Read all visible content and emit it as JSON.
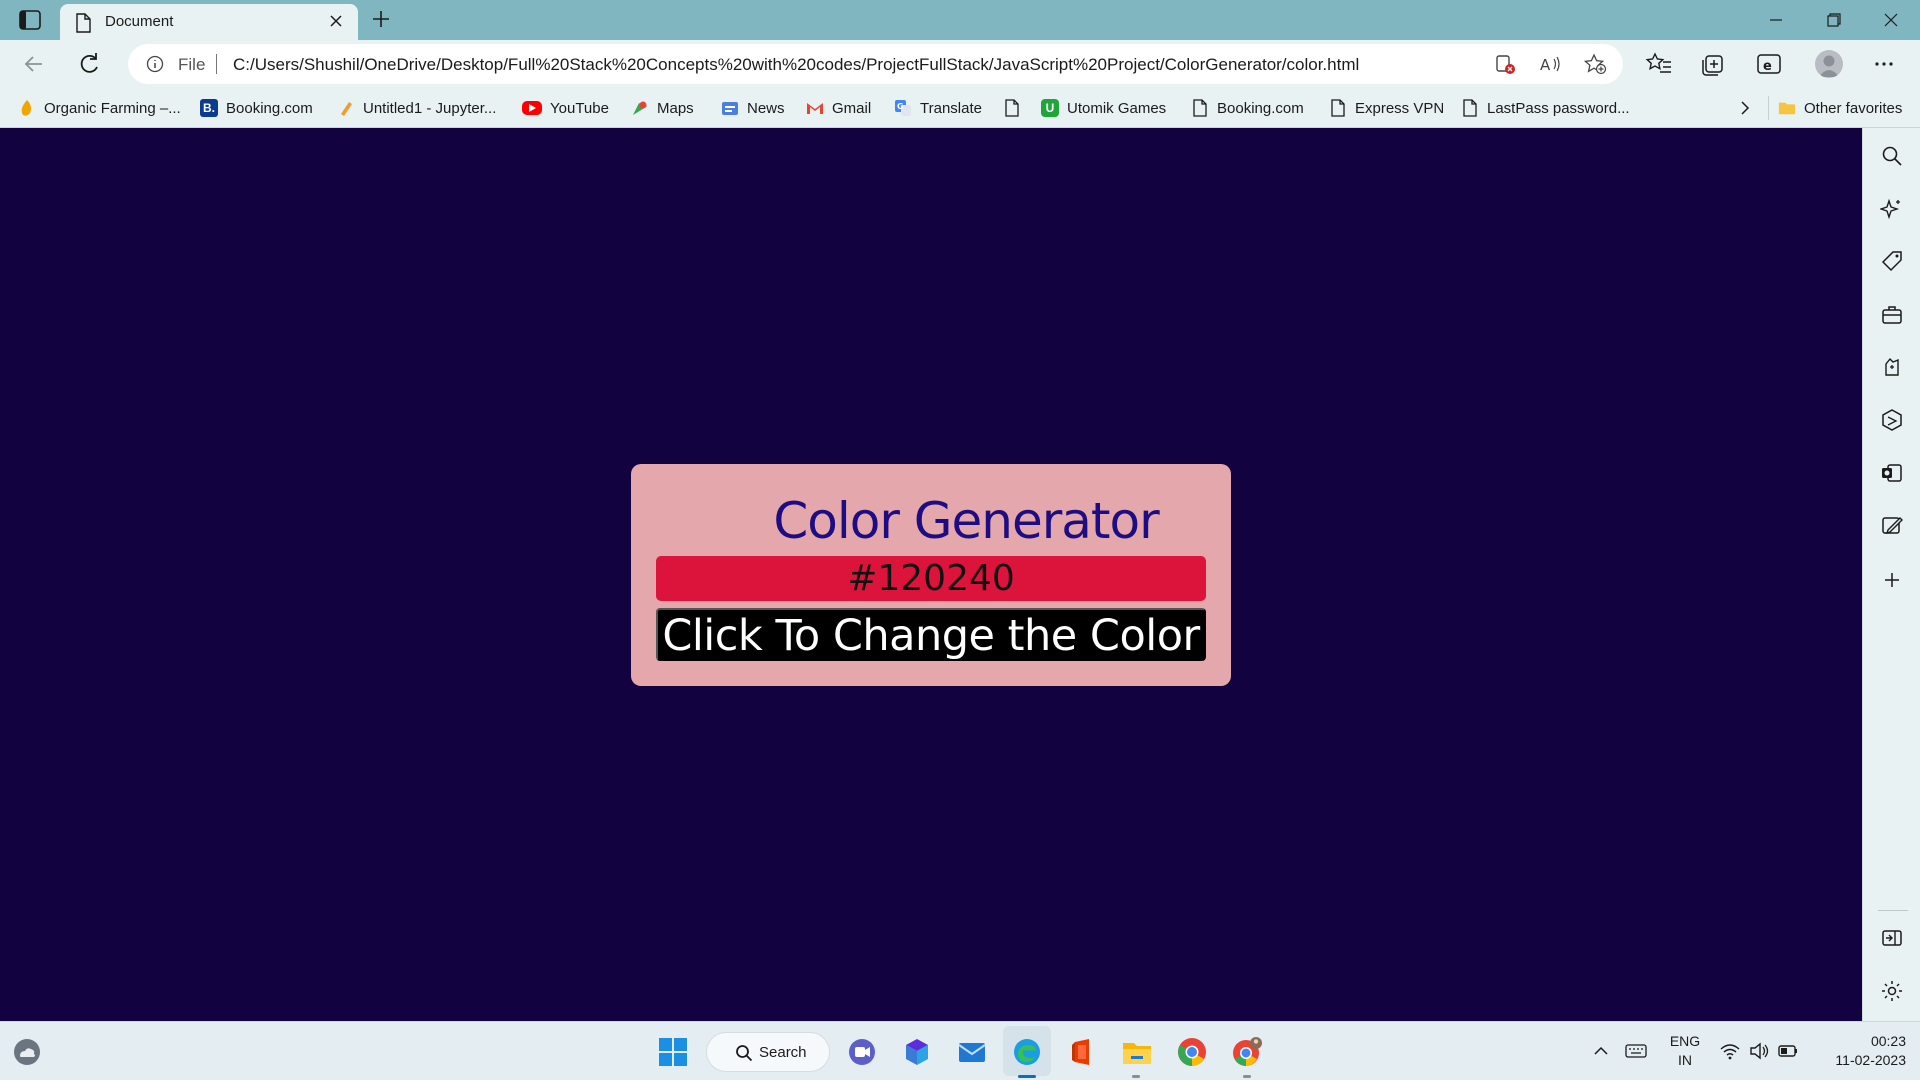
{
  "browser": {
    "tab_title": "Document",
    "address": {
      "prefix": "File",
      "url": "C:/Users/Shushil/OneDrive/Desktop/Full%20Stack%20Concepts%20with%20codes/ProjectFullStack/JavaScript%20Project/ColorGenerator/color.html"
    },
    "favorites": [
      {
        "label": "Organic Farming –...",
        "icon": "organic-farming-icon"
      },
      {
        "label": "Booking.com",
        "icon": "booking-icon"
      },
      {
        "label": "Untitled1 - Jupyter...",
        "icon": "jupyter-icon"
      },
      {
        "label": "YouTube",
        "icon": "youtube-icon"
      },
      {
        "label": "Maps",
        "icon": "maps-icon"
      },
      {
        "label": "News",
        "icon": "news-icon"
      },
      {
        "label": "Gmail",
        "icon": "gmail-icon"
      },
      {
        "label": "Translate",
        "icon": "translate-icon"
      },
      {
        "label": "",
        "icon": "page-icon"
      },
      {
        "label": "Utomik Games",
        "icon": "utomik-icon"
      },
      {
        "label": "Booking.com",
        "icon": "page-icon"
      },
      {
        "label": "Express VPN",
        "icon": "page-icon"
      },
      {
        "label": "LastPass password...",
        "icon": "page-icon"
      }
    ],
    "other_favorites": "Other favorites"
  },
  "app": {
    "title": "Color Generator",
    "color_value": "#120240",
    "button_label": "Click To Change the Color",
    "page_background": "#120240",
    "display_color": "#dc143c",
    "card_color": "#e4a7ab",
    "title_color": "#1e0c82"
  },
  "taskbar": {
    "search_label": "Search",
    "lang_primary": "ENG",
    "lang_secondary": "IN",
    "time": "00:23",
    "date": "11-02-2023"
  }
}
